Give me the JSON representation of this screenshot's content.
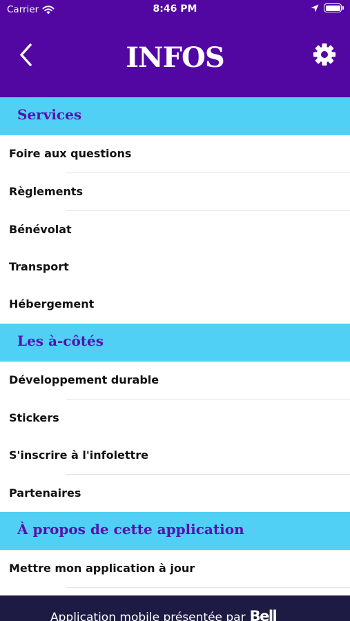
{
  "status_bar": {
    "carrier": "Carrier",
    "time": "8:46 PM"
  },
  "header": {
    "title": "INFOS"
  },
  "sections": [
    {
      "title": "Services",
      "items": [
        "Foire aux questions",
        "Règlements",
        "Bénévolat",
        "Transport",
        "Hébergement"
      ]
    },
    {
      "title": "Les à-côtés",
      "items": [
        "Développement durable",
        "Stickers",
        "S'inscrire à l'infolettre",
        "Partenaires"
      ]
    },
    {
      "title": "À propos de cette application",
      "items": [
        "Mettre mon application à jour"
      ]
    }
  ],
  "footer": {
    "text": "Application mobile présentée par",
    "brand": "Bell"
  },
  "colors": {
    "header_bg": "#5207a3",
    "section_bg": "#4fd0f4",
    "section_text": "#5b0fb0",
    "footer_bg": "#1d1b43"
  },
  "icons": {
    "back": "chevron-left-icon",
    "settings": "gear-icon",
    "wifi": "wifi-icon",
    "location": "location-arrow-icon",
    "battery": "battery-icon"
  }
}
